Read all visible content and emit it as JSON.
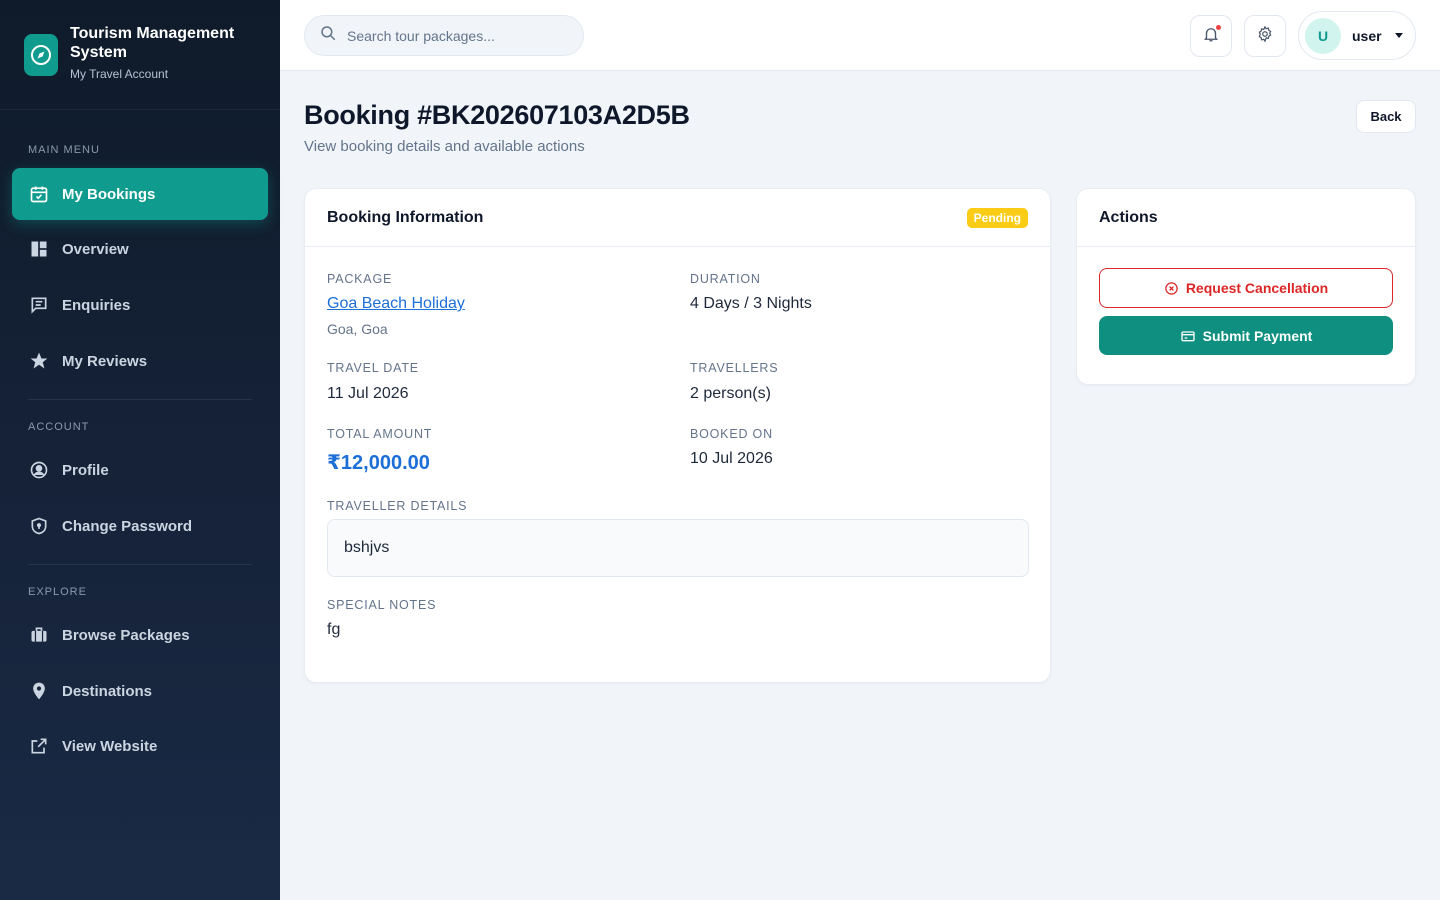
{
  "brand": {
    "title": "Tourism Management System",
    "subtitle": "My Travel Account"
  },
  "sidebar": {
    "sections": [
      {
        "label": "MAIN MENU",
        "items": [
          {
            "label": "My Bookings",
            "icon": "calendar-check-icon",
            "active": true
          },
          {
            "label": "Overview",
            "icon": "dashboard-icon"
          },
          {
            "label": "Enquiries",
            "icon": "chat-icon"
          },
          {
            "label": "My Reviews",
            "icon": "star-icon"
          }
        ]
      },
      {
        "label": "ACCOUNT",
        "items": [
          {
            "label": "Profile",
            "icon": "user-circle-icon"
          },
          {
            "label": "Change Password",
            "icon": "shield-lock-icon"
          }
        ]
      },
      {
        "label": "EXPLORE",
        "items": [
          {
            "label": "Browse Packages",
            "icon": "suitcase-icon"
          },
          {
            "label": "Destinations",
            "icon": "map-pin-icon"
          },
          {
            "label": "View Website",
            "icon": "external-link-icon"
          }
        ]
      }
    ]
  },
  "topbar": {
    "search_placeholder": "Search tour packages...",
    "user_initial": "U",
    "user_name": "user"
  },
  "page": {
    "title": "Booking #BK202607103A2D5B",
    "subtitle": "View booking details and available actions",
    "back_label": "Back"
  },
  "booking": {
    "card_title": "Booking Information",
    "status": "Pending",
    "package_label": "PACKAGE",
    "package_name": "Goa Beach Holiday",
    "package_location": "Goa, Goa",
    "duration_label": "DURATION",
    "duration": "4 Days / 3 Nights",
    "travel_date_label": "TRAVEL DATE",
    "travel_date": "11 Jul 2026",
    "travellers_label": "TRAVELLERS",
    "travellers": "2 person(s)",
    "total_label": "TOTAL AMOUNT",
    "total": "₹12,000.00",
    "booked_on_label": "BOOKED ON",
    "booked_on": "10 Jul 2026",
    "traveller_details_label": "TRAVELLER DETAILS",
    "traveller_details": "bshjvs",
    "notes_label": "SPECIAL NOTES",
    "notes": "fg"
  },
  "actions": {
    "title": "Actions",
    "cancel_label": "Request Cancellation",
    "pay_label": "Submit Payment"
  },
  "colors": {
    "accent": "#0f9b8e",
    "sidebar_bg": "#0f1b2a",
    "link": "#1d6fd8",
    "danger": "#dc2626",
    "pending": "#facc15"
  }
}
